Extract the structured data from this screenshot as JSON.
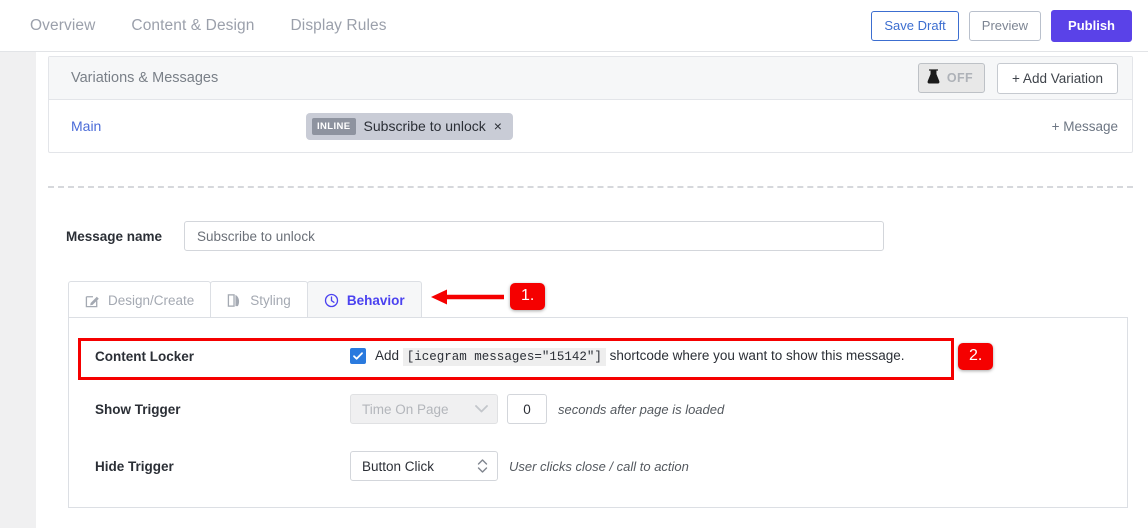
{
  "topnav": {
    "items": [
      {
        "label": "Overview"
      },
      {
        "label": "Content & Design"
      },
      {
        "label": "Display Rules"
      }
    ],
    "actions": {
      "save_draft": "Save Draft",
      "preview": "Preview",
      "publish": "Publish"
    }
  },
  "variations": {
    "title": "Variations & Messages",
    "ab_toggle_label": "OFF",
    "ab_toggle_icon": "flask-icon",
    "add_variation_label": "+  Add Variation",
    "row": {
      "name": "Main",
      "chip_badge": "INLINE",
      "chip_label": "Subscribe to unlock",
      "chip_close": "×"
    },
    "add_message_label": "+  Message"
  },
  "message_name": {
    "label": "Message name",
    "value": "Subscribe to unlock",
    "placeholder": "Message name"
  },
  "tabs": [
    {
      "label": "Design/Create",
      "icon": "edit-square-icon",
      "active": false
    },
    {
      "label": "Styling",
      "icon": "palette-icon",
      "active": false
    },
    {
      "label": "Behavior",
      "icon": "clock-icon",
      "active": true
    }
  ],
  "behavior": {
    "content_locker": {
      "label": "Content Locker",
      "checked": true,
      "text_before": "Add",
      "shortcode": "[icegram messages=\"15142\"]",
      "text_after": "shortcode where you want to show this message."
    },
    "show_trigger": {
      "label": "Show Trigger",
      "select_value": "Time On Page",
      "disabled": true,
      "number_value": "0",
      "hint": "seconds after page is loaded"
    },
    "hide_trigger": {
      "label": "Hide Trigger",
      "select_value": "Button Click",
      "disabled": false,
      "hint": "User clicks close / call to action"
    }
  },
  "annotations": {
    "badge_1": "1.",
    "badge_2": "2.",
    "arrow_color": "#f50000",
    "highlight_color": "#f50000"
  }
}
